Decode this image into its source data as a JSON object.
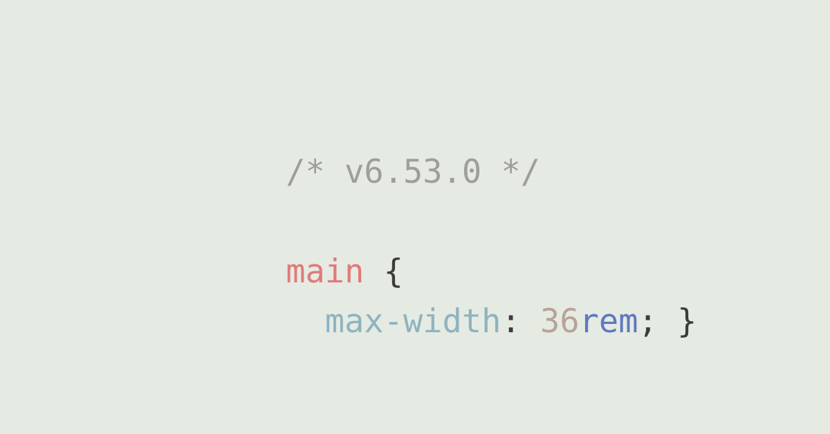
{
  "code": {
    "comment": "/* v6.53.0 */",
    "selector": "main",
    "open_brace": "{",
    "indent": "  ",
    "property": "max-width",
    "colon": ": ",
    "number": "36",
    "unit": "rem",
    "semicolon": "; ",
    "close_brace": "}"
  },
  "colors": {
    "background": "#e5ebe3",
    "comment": "#9e9e9a",
    "selector": "#e07a7a",
    "punctuation": "#3a3d3c",
    "property": "#8fb3bf",
    "number": "#b7a397",
    "unit": "#5f78c0"
  }
}
